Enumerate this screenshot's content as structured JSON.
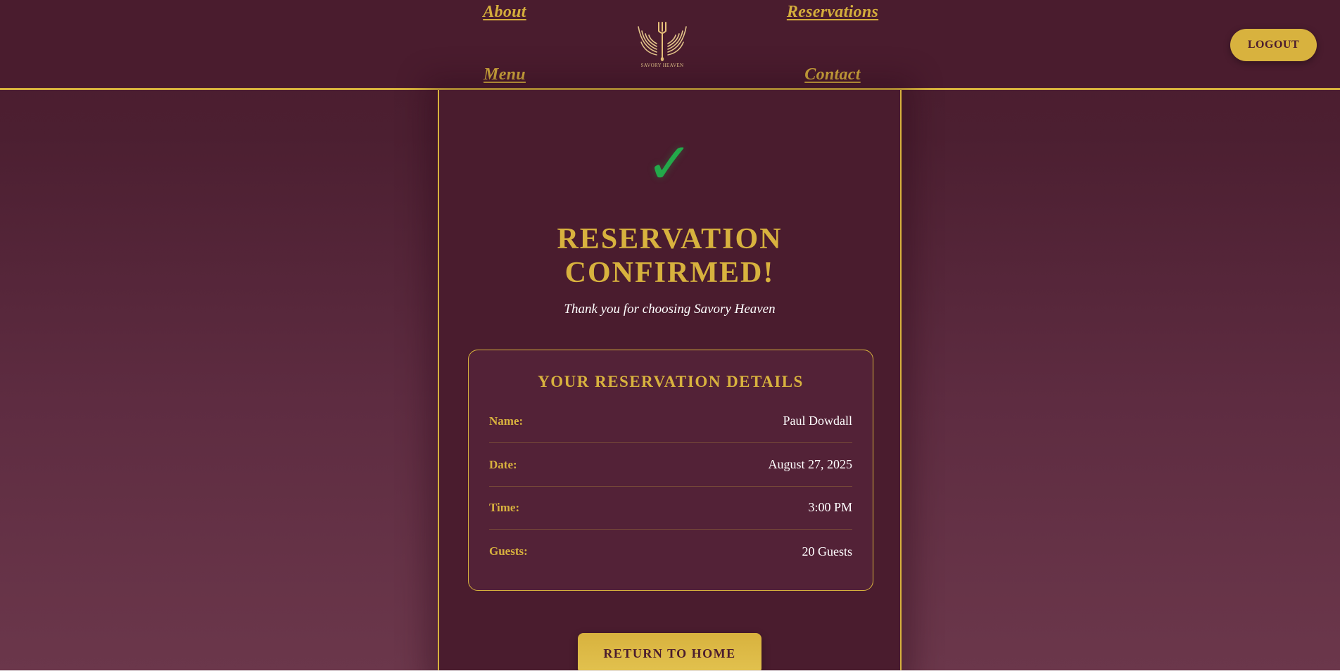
{
  "nav": {
    "about": "About",
    "reservations": "Reservations",
    "menu": "Menu",
    "contact": "Contact",
    "logout": "LOGOUT"
  },
  "logo": {
    "text": "SAVORY HEAVEN",
    "icon": "winged-fork-logo"
  },
  "confirmation": {
    "check_symbol": "✓",
    "check_color": "#23a94a",
    "title_line1": "RESERVATION",
    "title_line2": "CONFIRMED!",
    "subtitle": "Thank you for choosing Savory Heaven"
  },
  "details": {
    "title": "YOUR RESERVATION DETAILS",
    "rows": [
      {
        "label": "Name:",
        "value": "Paul Dowdall"
      },
      {
        "label": "Date:",
        "value": "August 27, 2025"
      },
      {
        "label": "Time:",
        "value": "3:00 PM"
      },
      {
        "label": "Guests:",
        "value": "20 Guests"
      }
    ]
  },
  "actions": {
    "return_home": "RETURN TO HOME"
  },
  "colors": {
    "background": "#4a1c2e",
    "accent_gold": "#d8b23e",
    "text": "#ffffff"
  }
}
